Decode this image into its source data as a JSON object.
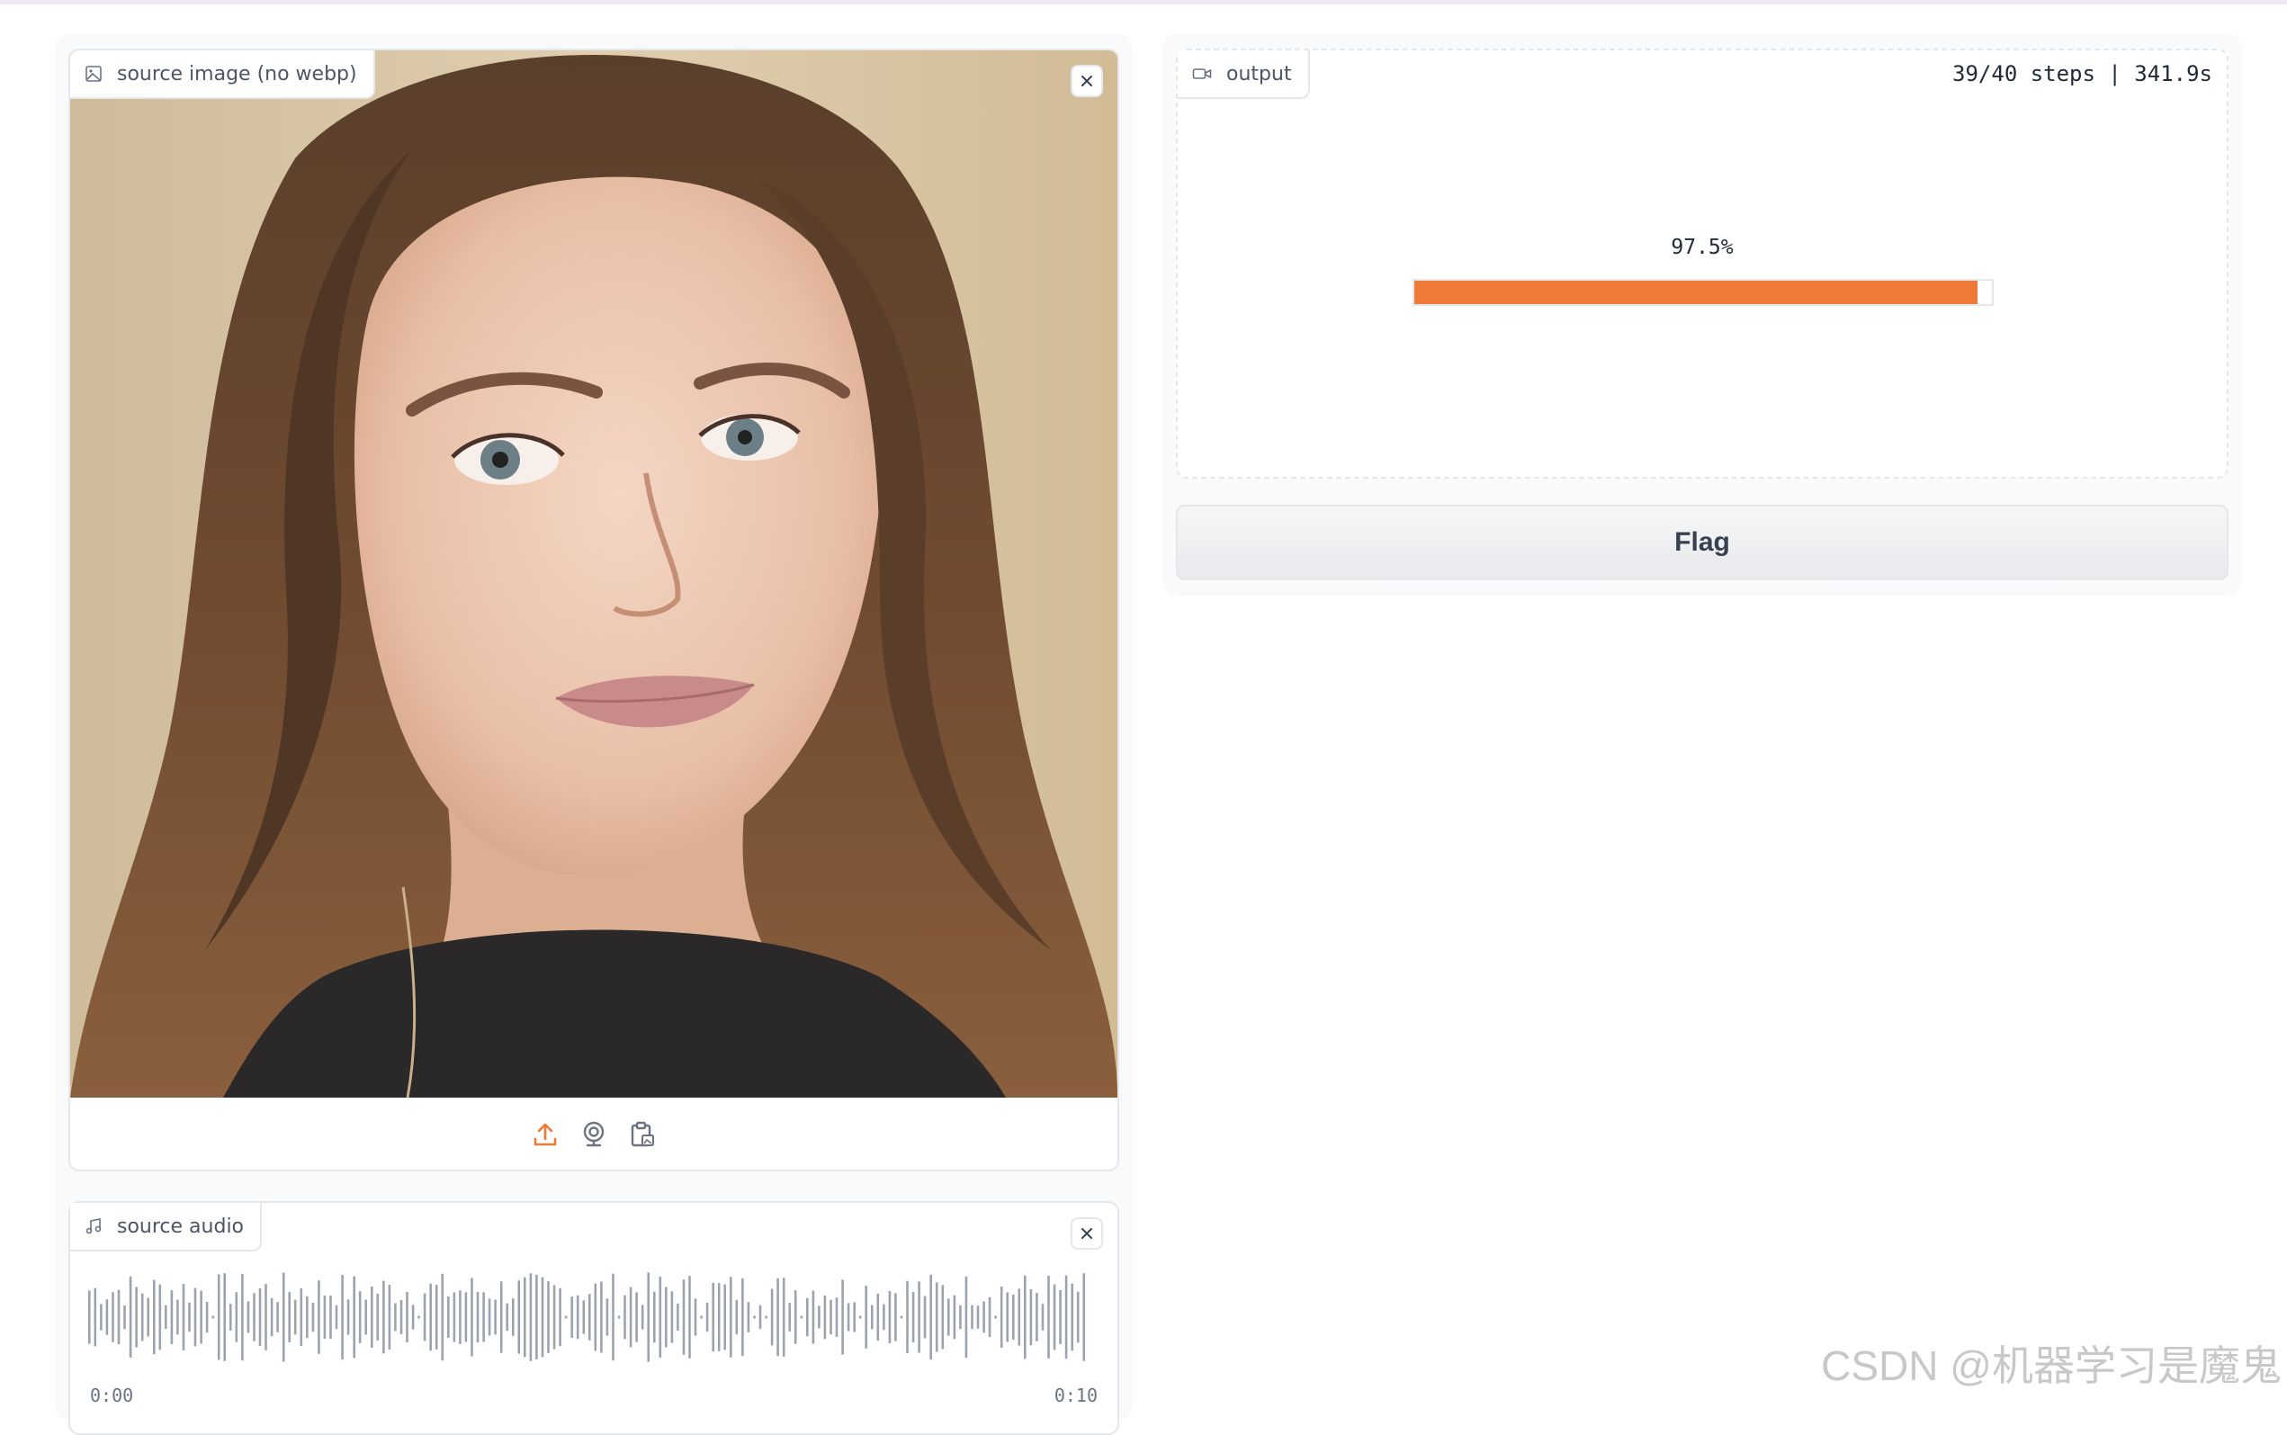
{
  "image_input": {
    "label": "source image (no webp)",
    "icon": "image-icon",
    "close_icon": "close-icon",
    "toolbar": [
      "upload-icon",
      "webcam-icon",
      "clipboard-icon"
    ]
  },
  "audio_input": {
    "label": "source audio",
    "icon": "music-note-icon",
    "close_icon": "close-icon",
    "time_start": "0:00",
    "time_end": "0:10"
  },
  "output": {
    "label": "output",
    "icon": "video-icon",
    "progress_info": "39/40 steps | 341.9s",
    "percent_label": "97.5%",
    "progress_fraction": 0.975
  },
  "flag_button": {
    "label": "Flag"
  },
  "watermark": "CSDN @机器学习是魔鬼",
  "colors": {
    "accent": "#ed7a36",
    "border": "#e5e7eb",
    "panel": "#f9fafb"
  }
}
